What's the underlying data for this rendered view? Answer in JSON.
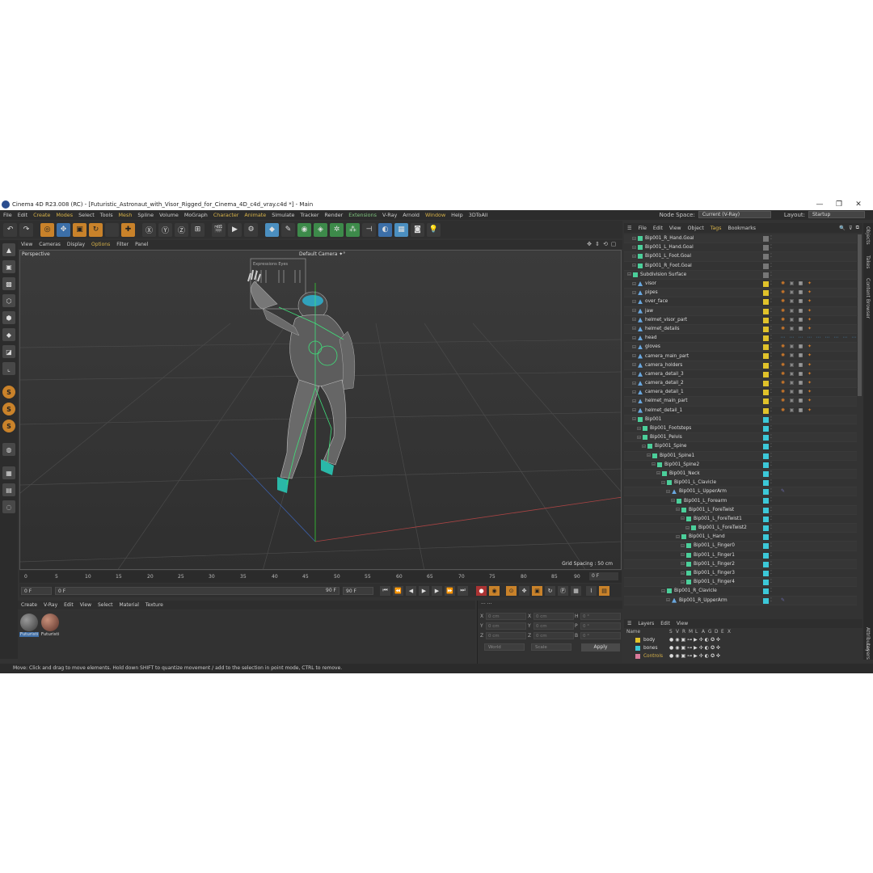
{
  "window": {
    "title": "Cinema 4D R23.008 (RC) - [Futuristic_Astronaut_with_Visor_Rigged_for_Cinema_4D_c4d_vray.c4d *] - Main",
    "controls": [
      "—",
      "❐",
      "✕"
    ]
  },
  "menubar": {
    "items": [
      "File",
      "Edit",
      "Create",
      "Modes",
      "Select",
      "Tools",
      "Mesh",
      "Spline",
      "Volume",
      "MoGraph",
      "Character",
      "Animate",
      "Simulate",
      "Tracker",
      "Render",
      "Extensions",
      "V-Ray",
      "Arnold",
      "Window",
      "Help",
      "3DToAll"
    ],
    "node_space_label": "Node Space:",
    "node_space_value": "Current (V-Ray)",
    "layout_label": "Layout:",
    "layout_value": "Startup"
  },
  "viewport": {
    "menu": [
      "View",
      "Cameras",
      "Display",
      "Options",
      "Filter",
      "Panel"
    ],
    "projection": "Perspective",
    "camera": "Default Camera ✦°",
    "grid_spacing": "Grid Spacing : 50 cm",
    "hud_title": "Expressions    Eyes"
  },
  "timeline": {
    "ticks": [
      "0",
      "5",
      "10",
      "15",
      "20",
      "25",
      "30",
      "35",
      "40",
      "45",
      "50",
      "55",
      "60",
      "65",
      "70",
      "75",
      "80",
      "85",
      "90"
    ],
    "current_frame": "0 F",
    "start": "0 F",
    "slider_start": "0 F",
    "slider_end": "90 F",
    "end": "90 F"
  },
  "materials": {
    "menu": [
      "Create",
      "V-Ray",
      "Edit",
      "View",
      "Select",
      "Material",
      "Texture"
    ],
    "items": [
      {
        "name": "Futuristi",
        "color": "#5a5a5a"
      },
      {
        "name": "Futuristi",
        "color": "#8a5a48"
      }
    ]
  },
  "coordinates": {
    "header": "···   ···",
    "rows": [
      {
        "a": "X",
        "av": "0 cm",
        "b": "X",
        "bv": "0 cm",
        "c": "H",
        "cv": "0 °"
      },
      {
        "a": "Y",
        "av": "0 cm",
        "b": "Y",
        "bv": "0 cm",
        "c": "P",
        "cv": "0 °"
      },
      {
        "a": "Z",
        "av": "0 cm",
        "b": "Z",
        "bv": "0 cm",
        "c": "B",
        "cv": "0 °"
      }
    ],
    "mode": "World",
    "scale": "Scale",
    "apply": "Apply"
  },
  "status": "Move: Click and drag to move elements. Hold down SHIFT to quantize movement / add to the selection in point mode, CTRL to remove.",
  "object_manager": {
    "menu": [
      "File",
      "Edit",
      "View",
      "Object",
      "Tags",
      "Bookmarks"
    ],
    "rows": [
      {
        "name": "Bip001_R_Hand.Goal",
        "indent": 1,
        "color": "#777777",
        "tags": 0
      },
      {
        "name": "Bip001_L_Hand.Goal",
        "indent": 1,
        "color": "#777777",
        "tags": 0
      },
      {
        "name": "Bip001_L_Foot.Goal",
        "indent": 1,
        "color": "#777777",
        "tags": 0
      },
      {
        "name": "Bip001_R_Foot.Goal",
        "indent": 1,
        "color": "#777777",
        "tags": 0
      },
      {
        "name": "Subdivision Surface",
        "indent": 0,
        "color": "#777777",
        "tags": 0
      },
      {
        "name": "visor",
        "indent": 1,
        "color": "#e0c22a",
        "tags": 1
      },
      {
        "name": "pipes",
        "indent": 1,
        "color": "#e0c22a",
        "tags": 1
      },
      {
        "name": "over_face",
        "indent": 1,
        "color": "#e0c22a",
        "tags": 1
      },
      {
        "name": "jaw",
        "indent": 1,
        "color": "#e0c22a",
        "tags": 1
      },
      {
        "name": "helmet_visor_part",
        "indent": 1,
        "color": "#e0c22a",
        "tags": 1
      },
      {
        "name": "helmet_details",
        "indent": 1,
        "color": "#e0c22a",
        "tags": 1
      },
      {
        "name": "head",
        "indent": 1,
        "color": "#e0c22a",
        "tags": 2
      },
      {
        "name": "gloves",
        "indent": 1,
        "color": "#e0c22a",
        "tags": 1
      },
      {
        "name": "camera_main_part",
        "indent": 1,
        "color": "#e0c22a",
        "tags": 1
      },
      {
        "name": "camera_holders",
        "indent": 1,
        "color": "#e0c22a",
        "tags": 1
      },
      {
        "name": "camera_detail_3",
        "indent": 1,
        "color": "#e0c22a",
        "tags": 1
      },
      {
        "name": "camera_detail_2",
        "indent": 1,
        "color": "#e0c22a",
        "tags": 1
      },
      {
        "name": "camera_detail_1",
        "indent": 1,
        "color": "#e0c22a",
        "tags": 1
      },
      {
        "name": "helmet_main_part",
        "indent": 1,
        "color": "#e0c22a",
        "tags": 1
      },
      {
        "name": "helmet_detail_1",
        "indent": 1,
        "color": "#e0c22a",
        "tags": 1
      },
      {
        "name": "Bip001",
        "indent": 1,
        "color": "#3cc8d8",
        "tags": 0
      },
      {
        "name": "Bip001_Footsteps",
        "indent": 2,
        "color": "#3cc8d8",
        "tags": 0
      },
      {
        "name": "Bip001_Pelvis",
        "indent": 2,
        "color": "#3cc8d8",
        "tags": 0
      },
      {
        "name": "Bip001_Spine",
        "indent": 3,
        "color": "#3cc8d8",
        "tags": 0
      },
      {
        "name": "Bip001_Spine1",
        "indent": 4,
        "color": "#3cc8d8",
        "tags": 0
      },
      {
        "name": "Bip001_Spine2",
        "indent": 5,
        "color": "#3cc8d8",
        "tags": 0
      },
      {
        "name": "Bip001_Neck",
        "indent": 6,
        "color": "#3cc8d8",
        "tags": 0
      },
      {
        "name": "Bip001_L_Clavicle",
        "indent": 7,
        "color": "#3cc8d8",
        "tags": 0
      },
      {
        "name": "Bip001_L_UpperArm",
        "indent": 8,
        "color": "#3cc8d8",
        "tags": 3
      },
      {
        "name": "Bip001_L_Forearm",
        "indent": 9,
        "color": "#3cc8d8",
        "tags": 0
      },
      {
        "name": "Bip001_L_ForeTwist",
        "indent": 10,
        "color": "#3cc8d8",
        "tags": 0
      },
      {
        "name": "Bip001_L_ForeTwist1",
        "indent": 11,
        "color": "#3cc8d8",
        "tags": 0
      },
      {
        "name": "Bip001_L_ForeTwist2",
        "indent": 12,
        "color": "#3cc8d8",
        "tags": 0
      },
      {
        "name": "Bip001_L_Hand",
        "indent": 10,
        "color": "#3cc8d8",
        "tags": 0
      },
      {
        "name": "Bip001_L_Finger0",
        "indent": 11,
        "color": "#3cc8d8",
        "tags": 0
      },
      {
        "name": "Bip001_L_Finger1",
        "indent": 11,
        "color": "#3cc8d8",
        "tags": 0
      },
      {
        "name": "Bip001_L_Finger2",
        "indent": 11,
        "color": "#3cc8d8",
        "tags": 0
      },
      {
        "name": "Bip001_L_Finger3",
        "indent": 11,
        "color": "#3cc8d8",
        "tags": 0
      },
      {
        "name": "Bip001_L_Finger4",
        "indent": 11,
        "color": "#3cc8d8",
        "tags": 0
      },
      {
        "name": "Bip001_R_Clavicle",
        "indent": 7,
        "color": "#3cc8d8",
        "tags": 0
      },
      {
        "name": "Bip001_R_UpperArm",
        "indent": 8,
        "color": "#3cc8d8",
        "tags": 3
      }
    ]
  },
  "layers": {
    "menu": [
      "Layers",
      "Edit",
      "View"
    ],
    "columns": [
      "Name",
      "S",
      "V",
      "R",
      "M",
      "L",
      "A",
      "G",
      "D",
      "E",
      "X"
    ],
    "rows": [
      {
        "name": "body",
        "color": "#e0c22a",
        "text_color": "#dddddd"
      },
      {
        "name": "bones",
        "color": "#3cc8d8",
        "text_color": "#dddddd"
      },
      {
        "name": "Controls",
        "color": "#d87a9a",
        "text_color": "#d8b34a"
      }
    ]
  },
  "right_tabs": [
    "Objects",
    "Takes",
    "Content Browser",
    "Attributes",
    "Layers",
    "Structure"
  ]
}
